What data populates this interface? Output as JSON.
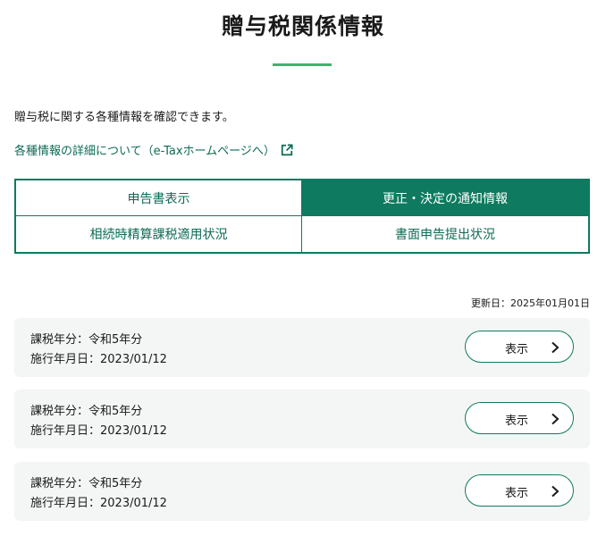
{
  "header": {
    "title": "贈与税関係情報"
  },
  "intro": {
    "text": "贈与税に関する各種情報を確認できます。"
  },
  "detail_link": {
    "label": "各種情報の詳細について（e-Taxホームページへ）",
    "icon": "external-link-icon"
  },
  "tabs": [
    {
      "label": "申告書表示",
      "active": false
    },
    {
      "label": "更正・決定の通知情報",
      "active": true
    },
    {
      "label": "相続時精算課税適用状況",
      "active": false
    },
    {
      "label": "書面申告提出状況",
      "active": false
    }
  ],
  "updated": {
    "text": "更新日：2025年01月01日"
  },
  "records": [
    {
      "tax_year": "課税年分：令和5年分",
      "effective_date": "施行年月日：2023/01/12",
      "button_label": "表示"
    },
    {
      "tax_year": "課税年分：令和5年分",
      "effective_date": "施行年月日：2023/01/12",
      "button_label": "表示"
    },
    {
      "tax_year": "課税年分：令和5年分",
      "effective_date": "施行年月日：2023/01/12",
      "button_label": "表示"
    }
  ],
  "colors": {
    "accent": "#0e7a60",
    "link": "#0e6b55",
    "title_underline": "#3cb371",
    "card_background": "#f4f6f5"
  }
}
